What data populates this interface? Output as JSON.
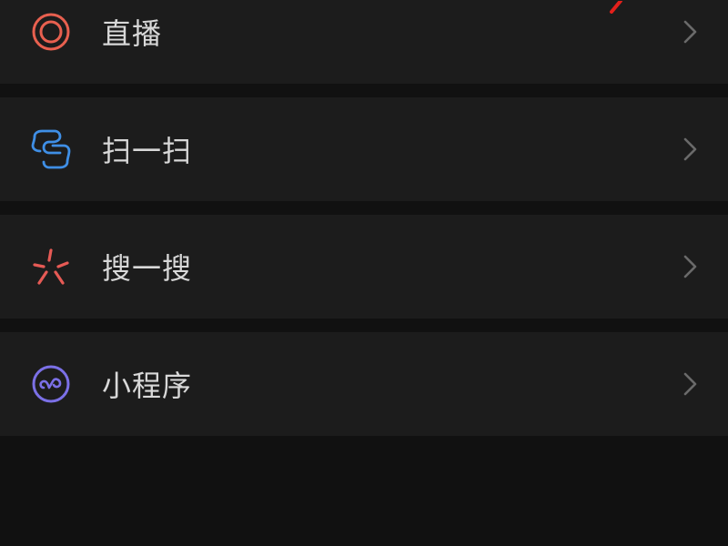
{
  "menu": {
    "items": [
      {
        "label": "直播",
        "icon": "live-icon",
        "accent": "#e8604f"
      },
      {
        "label": "扫一扫",
        "icon": "scan-icon",
        "accent": "#3f8fe6"
      },
      {
        "label": "搜一搜",
        "icon": "search-sparkle-icon",
        "accent": "#e65a55"
      },
      {
        "label": "小程序",
        "icon": "mini-program-icon",
        "accent": "#7b70e6"
      }
    ]
  },
  "colors": {
    "background": "#111111",
    "row": "#1c1c1c",
    "label": "#d8d8d8",
    "chevron": "#6a6a6a",
    "annotation": "#e3201b"
  }
}
